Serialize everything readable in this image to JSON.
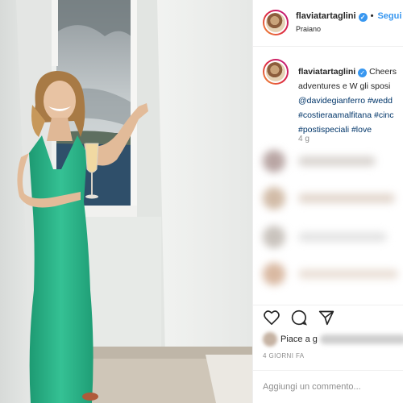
{
  "post": {
    "username": "flaviatartaglini",
    "verified_icon": "verified-badge-icon",
    "separator": "•",
    "follow_label": "Segui",
    "location": "Praiano"
  },
  "caption": {
    "username": "flaviatartaglini",
    "line1": "Cheers",
    "line2": "adventures e W gli sposi",
    "mention": "@davidegianferro",
    "tag_partial": "#wedd",
    "tag_line3": "#costieraamalfitana",
    "tag_line3b": "#cinc",
    "tag_line4a": "#postispeciali",
    "tag_line4b": "#love",
    "time": "4 g"
  },
  "comments": {
    "blurred_label": "fede... go"
  },
  "actions": {
    "like_icon": "heart-icon",
    "comment_icon": "comment-icon",
    "share_icon": "share-icon",
    "likes_prefix": "Piace a",
    "likes_partial": "g",
    "likes_suffix": "e e",
    "age": "4 GIORNI FA"
  },
  "add_comment": {
    "placeholder": "Aggiungi un commento..."
  },
  "colors": {
    "accent": "#3897f0",
    "dress": "#2fb58a",
    "hashtag": "#003569"
  }
}
